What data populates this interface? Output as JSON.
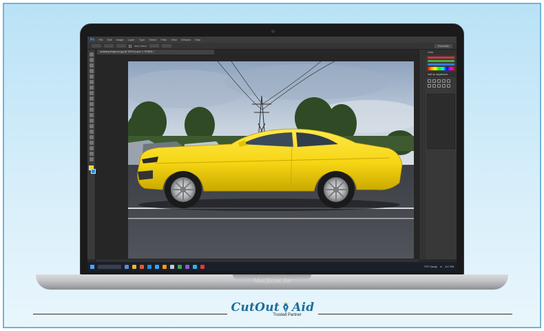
{
  "device": {
    "label": "MacBook Air"
  },
  "app": {
    "menu": [
      "File",
      "Edit",
      "Image",
      "Layer",
      "Type",
      "Select",
      "Filter",
      "View",
      "Window",
      "Help"
    ],
    "options_text": "Auto-Select",
    "workspace": "Essentials",
    "document_tab": "mustang-image-ps.jpg @ 100% (Layer 1, RGB/8) *"
  },
  "panels": {
    "color_title": "Color",
    "adjustments_title": "Add an adjustment"
  },
  "taskbar": {
    "weather": "73°F  Cloudy",
    "time": "4:17 PM"
  },
  "brand": {
    "name_left": "CutOut",
    "name_right": "Aid",
    "tagline": "Trusted Partner",
    "colors": {
      "primary": "#1b6e9c",
      "accent": "#f7d21d"
    }
  },
  "photo": {
    "subject": "yellow-sports-car",
    "car_color": "#f5d513"
  }
}
